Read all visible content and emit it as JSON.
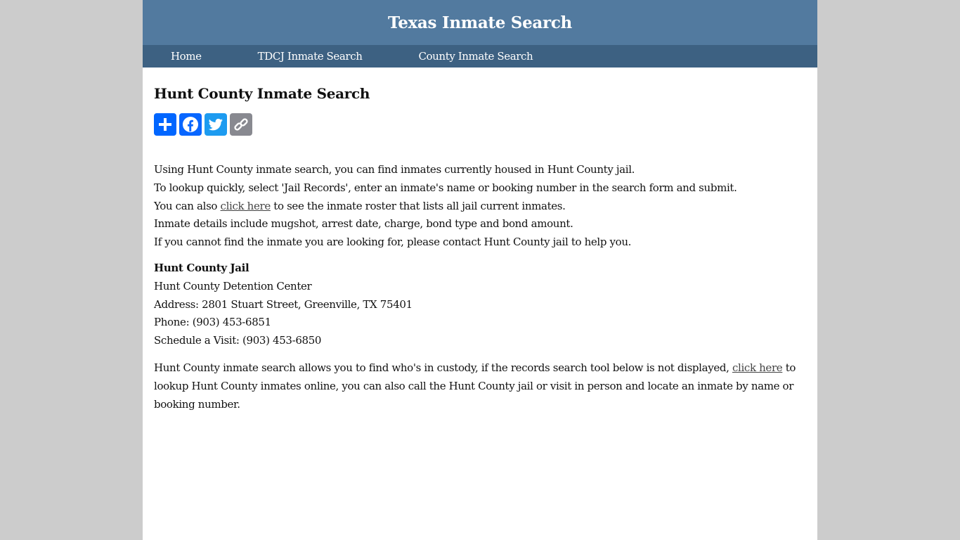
{
  "site": {
    "title": "Texas Inmate Search",
    "nav": [
      "Home",
      "TDCJ Inmate Search",
      "County Inmate Search"
    ]
  },
  "page": {
    "heading": "Hunt County Inmate Search",
    "share_buttons": [
      {
        "name": "share-add",
        "icon": "plus-icon",
        "color": "#0166ff"
      },
      {
        "name": "share-facebook",
        "icon": "facebook-icon",
        "color": "#0866ff"
      },
      {
        "name": "share-twitter",
        "icon": "twitter-icon",
        "color": "#1d9bf0"
      },
      {
        "name": "share-copy-link",
        "icon": "link-icon",
        "color": "#888990"
      }
    ],
    "intro": {
      "line1": "Using Hunt County inmate search, you can find inmates currently housed in Hunt County jail.",
      "line2": "To lookup quickly, select 'Jail Records', enter an inmate's name or booking number in the search form and submit.",
      "line3_before": "You can also ",
      "line3_link": "click here",
      "line3_after": " to see the inmate roster that lists all jail current inmates.",
      "line4": "Inmate details include mugshot, arrest date, charge, bond type and bond amount.",
      "line5": "If you cannot find the inmate you are looking for, please contact Hunt County jail to help you."
    },
    "jail": {
      "title": "Hunt County Jail",
      "facility": "Hunt County Detention Center",
      "address": "Address: 2801 Stuart Street, Greenville, TX 75401",
      "phone": "Phone: (903) 453-6851",
      "visit": "Schedule a Visit: (903) 453-6850"
    },
    "outro": {
      "before": "Hunt County inmate search allows you to find who's in custody, if the records search tool below is not displayed, ",
      "link": "click here",
      "after": " to lookup Hunt County inmates online, you can also call the Hunt County jail or visit in person and locate an inmate by name or booking number."
    }
  }
}
